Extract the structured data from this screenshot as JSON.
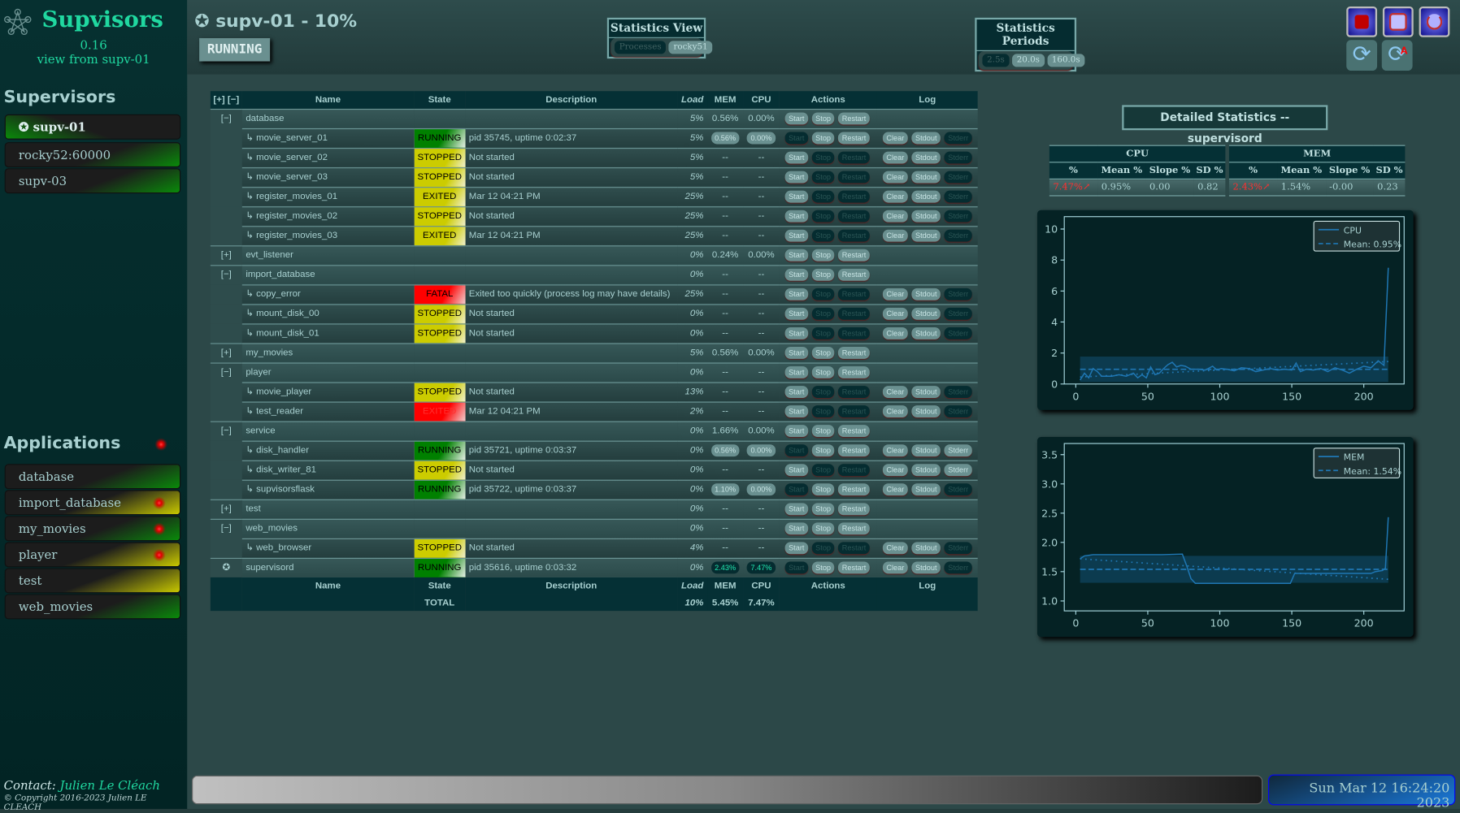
{
  "sidebar": {
    "brand": "Supvisors",
    "version": "0.16",
    "view_from": "view from supv-01",
    "supervisors_title": "Supervisors",
    "supervisors": [
      {
        "label": "supv-01",
        "selected": true
      },
      {
        "label": "rocky52:60000"
      },
      {
        "label": "supv-03"
      }
    ],
    "applications_title": "Applications",
    "applications": [
      {
        "label": "database",
        "color": "green",
        "alert": false
      },
      {
        "label": "import_database",
        "color": "yellow",
        "alert": true
      },
      {
        "label": "my_movies",
        "color": "green",
        "alert": true
      },
      {
        "label": "player",
        "color": "yellow",
        "alert": true
      },
      {
        "label": "test",
        "color": "yellow",
        "alert": false
      },
      {
        "label": "web_movies",
        "color": "green",
        "alert": false
      }
    ],
    "contact_label": "Contact:",
    "contact_name": "Julien Le Cléach",
    "copyright": "© Copyright 2016-2023 Julien LE CLEACH"
  },
  "header": {
    "title": "supv-01 - 10%",
    "state": "RUNNING",
    "stats_view": {
      "title": "Statistics View",
      "options": [
        "Processes",
        "rocky51"
      ],
      "selected": "Processes"
    },
    "stats_periods": {
      "title": "Statistics Periods",
      "options": [
        "2.5s",
        "20.0s",
        "160.0s"
      ],
      "selected": "2.5s"
    },
    "icons": [
      "stop-all-icon",
      "restart-icon",
      "shutdown-icon",
      "refresh-icon",
      "auto-refresh-icon"
    ]
  },
  "table": {
    "columns": {
      "expand": "[+] [−]",
      "name": "Name",
      "state": "State",
      "description": "Description",
      "load": "Load",
      "mem": "MEM",
      "cpu": "CPU",
      "actions": "Actions",
      "log": "Log"
    },
    "buttons": [
      "Start",
      "Stop",
      "Restart",
      "Clear",
      "Stdout",
      "Stderr"
    ],
    "rows": [
      {
        "type": "group",
        "expander": "[−]",
        "name": "database",
        "load": "5%",
        "mem": "0.56%",
        "cpu": "0.00%",
        "enabled": [
          1,
          1,
          1
        ]
      },
      {
        "type": "process",
        "name": "movie_server_01",
        "state": "RUNNING",
        "description": "pid 35745, uptime 0:02:37",
        "load": "5%",
        "mem": "0.56%",
        "cpu": "0.00%",
        "enabled": [
          0,
          1,
          1,
          1,
          1,
          0
        ]
      },
      {
        "type": "process",
        "name": "movie_server_02",
        "state": "STOPPED",
        "description": "Not started",
        "load": "5%",
        "mem": "--",
        "cpu": "--",
        "enabled": [
          1,
          0,
          0,
          1,
          1,
          0
        ]
      },
      {
        "type": "process",
        "name": "movie_server_03",
        "state": "STOPPED",
        "description": "Not started",
        "load": "5%",
        "mem": "--",
        "cpu": "--",
        "enabled": [
          1,
          0,
          0,
          1,
          1,
          0
        ]
      },
      {
        "type": "process",
        "name": "register_movies_01",
        "state": "EXITED",
        "description": "Mar 12 04:21 PM",
        "load": "25%",
        "mem": "--",
        "cpu": "--",
        "enabled": [
          1,
          0,
          0,
          1,
          1,
          0
        ]
      },
      {
        "type": "process",
        "name": "register_movies_02",
        "state": "STOPPED",
        "description": "Not started",
        "load": "25%",
        "mem": "--",
        "cpu": "--",
        "enabled": [
          1,
          0,
          0,
          1,
          1,
          0
        ]
      },
      {
        "type": "process",
        "name": "register_movies_03",
        "state": "EXITED",
        "description": "Mar 12 04:21 PM",
        "load": "25%",
        "mem": "--",
        "cpu": "--",
        "enabled": [
          1,
          0,
          0,
          1,
          1,
          0
        ]
      },
      {
        "type": "group",
        "expander": "[+]",
        "name": "evt_listener",
        "load": "0%",
        "mem": "0.24%",
        "cpu": "0.00%",
        "enabled": [
          1,
          1,
          1
        ]
      },
      {
        "type": "group",
        "expander": "[−]",
        "name": "import_database",
        "load": "0%",
        "mem": "--",
        "cpu": "--",
        "enabled": [
          1,
          1,
          1
        ]
      },
      {
        "type": "process",
        "name": "copy_error",
        "state": "FATAL",
        "description": "Exited too quickly (process log may have details)",
        "load": "25%",
        "mem": "--",
        "cpu": "--",
        "enabled": [
          1,
          0,
          0,
          1,
          1,
          0
        ]
      },
      {
        "type": "process",
        "name": "mount_disk_00",
        "state": "STOPPED",
        "description": "Not started",
        "load": "0%",
        "mem": "--",
        "cpu": "--",
        "enabled": [
          1,
          0,
          0,
          1,
          1,
          0
        ]
      },
      {
        "type": "process",
        "name": "mount_disk_01",
        "state": "STOPPED",
        "description": "Not started",
        "load": "0%",
        "mem": "--",
        "cpu": "--",
        "enabled": [
          1,
          0,
          0,
          1,
          1,
          0
        ]
      },
      {
        "type": "group",
        "expander": "[+]",
        "name": "my_movies",
        "load": "5%",
        "mem": "0.56%",
        "cpu": "0.00%",
        "enabled": [
          1,
          1,
          1
        ]
      },
      {
        "type": "group",
        "expander": "[−]",
        "name": "player",
        "load": "0%",
        "mem": "--",
        "cpu": "--",
        "enabled": [
          1,
          1,
          1
        ]
      },
      {
        "type": "process",
        "name": "movie_player",
        "state": "STOPPED",
        "description": "Not started",
        "load": "13%",
        "mem": "--",
        "cpu": "--",
        "enabled": [
          1,
          0,
          0,
          1,
          1,
          0
        ]
      },
      {
        "type": "process",
        "name": "test_reader",
        "state": "EXITED",
        "state_alert": true,
        "description": "Mar 12 04:21 PM",
        "load": "2%",
        "mem": "--",
        "cpu": "--",
        "enabled": [
          1,
          0,
          0,
          1,
          1,
          0
        ]
      },
      {
        "type": "group",
        "expander": "[−]",
        "name": "service",
        "load": "0%",
        "mem": "1.66%",
        "cpu": "0.00%",
        "enabled": [
          1,
          1,
          1
        ]
      },
      {
        "type": "process",
        "name": "disk_handler",
        "state": "RUNNING",
        "description": "pid 35721, uptime 0:03:37",
        "load": "0%",
        "mem": "0.56%",
        "cpu": "0.00%",
        "enabled": [
          0,
          1,
          1,
          1,
          1,
          1
        ]
      },
      {
        "type": "process",
        "name": "disk_writer_81",
        "state": "STOPPED",
        "description": "Not started",
        "load": "0%",
        "mem": "--",
        "cpu": "--",
        "enabled": [
          1,
          0,
          0,
          1,
          1,
          1
        ]
      },
      {
        "type": "process",
        "name": "supvisorsflask",
        "state": "RUNNING",
        "description": "pid 35722, uptime 0:03:37",
        "load": "0%",
        "mem": "1.10%",
        "cpu": "0.00%",
        "enabled": [
          0,
          1,
          1,
          1,
          1,
          0
        ]
      },
      {
        "type": "group",
        "expander": "[+]",
        "name": "test",
        "load": "0%",
        "mem": "--",
        "cpu": "--",
        "enabled": [
          1,
          1,
          1
        ]
      },
      {
        "type": "group",
        "expander": "[−]",
        "name": "web_movies",
        "load": "0%",
        "mem": "--",
        "cpu": "--",
        "enabled": [
          1,
          1,
          1
        ]
      },
      {
        "type": "process",
        "name": "web_browser",
        "state": "STOPPED",
        "description": "Not started",
        "load": "4%",
        "mem": "--",
        "cpu": "--",
        "enabled": [
          1,
          0,
          0,
          1,
          1,
          0
        ]
      },
      {
        "type": "supervisor",
        "expander": "✪",
        "name": "supervisord",
        "state": "RUNNING",
        "description": "pid 35616, uptime 0:03:32",
        "load": "0%",
        "mem": "2.43%",
        "cpu": "7.47%",
        "selected": true,
        "enabled": [
          0,
          1,
          1,
          1,
          1,
          0
        ]
      }
    ],
    "total": {
      "label": "TOTAL",
      "load": "10%",
      "mem": "5.45%",
      "cpu": "7.47%"
    }
  },
  "details": {
    "title": "Detailed Statistics -- supervisord",
    "cpu": {
      "title": "CPU",
      "headers": [
        "%",
        "Mean %",
        "Slope %",
        "SD %"
      ],
      "values": [
        "7.47%↗",
        "0.95%",
        "0.00",
        "0.82"
      ]
    },
    "mem": {
      "title": "MEM",
      "headers": [
        "%",
        "Mean %",
        "Slope %",
        "SD %"
      ],
      "values": [
        "2.43%↗",
        "1.54%",
        "-0.00",
        "0.23"
      ]
    }
  },
  "chart_data": [
    {
      "type": "line",
      "series": [
        {
          "name": "CPU",
          "x": [
            3,
            6,
            9,
            12,
            15,
            18,
            21,
            25,
            30,
            35,
            40,
            43,
            46,
            49,
            52,
            55,
            58,
            61,
            64,
            67,
            70,
            73,
            76,
            80,
            85,
            90,
            95,
            98,
            101,
            105,
            110,
            115,
            120,
            125,
            130,
            135,
            140,
            145,
            150,
            153,
            156,
            160,
            165,
            170,
            175,
            180,
            185,
            190,
            195,
            200,
            205,
            210,
            214,
            217
          ],
          "y": [
            0.25,
            0.7,
            0.4,
            1.0,
            0.8,
            0.5,
            0.5,
            0.5,
            0.6,
            0.5,
            0.7,
            0.4,
            0.6,
            0.4,
            1.1,
            0.6,
            0.7,
            1.0,
            1.25,
            1.4,
            1.1,
            1.2,
            1.15,
            0.95,
            0.95,
            0.9,
            1.15,
            0.9,
            1.0,
            0.95,
            0.85,
            1.05,
            1.0,
            0.8,
            0.9,
            1.0,
            0.9,
            0.95,
            0.9,
            1.35,
            0.8,
            0.95,
            0.9,
            1.0,
            0.8,
            1.05,
            0.9,
            0.7,
            0.95,
            1.15,
            1.05,
            1.5,
            1.2,
            7.5
          ]
        },
        {
          "name": "Mean: 0.95%",
          "style": "dashed",
          "value": 0.95
        }
      ],
      "band": [
        0.13,
        1.77
      ],
      "trend": [
        [
          3,
          0.45
        ],
        [
          217,
          1.45
        ]
      ],
      "xticks": [
        0,
        50,
        100,
        150,
        200
      ],
      "yticks": [
        0,
        2,
        4,
        6,
        8,
        10
      ],
      "xlim": [
        -8,
        228
      ],
      "ylim": [
        0,
        10.8
      ],
      "legend": "top-right"
    },
    {
      "type": "line",
      "series": [
        {
          "name": "MEM",
          "x": [
            3,
            6,
            12,
            20,
            40,
            60,
            74,
            77,
            80,
            83,
            90,
            100,
            120,
            149,
            152,
            160,
            180,
            205,
            208,
            213,
            215,
            217
          ],
          "y": [
            1.72,
            1.77,
            1.79,
            1.79,
            1.79,
            1.79,
            1.8,
            1.6,
            1.38,
            1.3,
            1.3,
            1.3,
            1.3,
            1.3,
            1.47,
            1.47,
            1.47,
            1.47,
            1.5,
            1.52,
            1.56,
            2.43
          ]
        },
        {
          "name": "Mean: 1.54%",
          "style": "dashed",
          "value": 1.54
        }
      ],
      "band": [
        1.31,
        1.77
      ],
      "trend": [
        [
          3,
          1.72
        ],
        [
          217,
          1.37
        ]
      ],
      "xticks": [
        0,
        50,
        100,
        150,
        200
      ],
      "yticks": [
        1.0,
        1.5,
        2.0,
        2.5,
        3.0,
        3.5
      ],
      "xlim": [
        -8,
        228
      ],
      "ylim": [
        0.83,
        3.69
      ],
      "legend": "top-right"
    }
  ],
  "footer": {
    "datetime": "Sun Mar 12 16:24:20 2023"
  },
  "colors": {
    "accent": "#20d8a0",
    "running": "#008000",
    "stopped": "#cccc00",
    "fatal": "#ff0000",
    "line": "#1f77b4"
  }
}
